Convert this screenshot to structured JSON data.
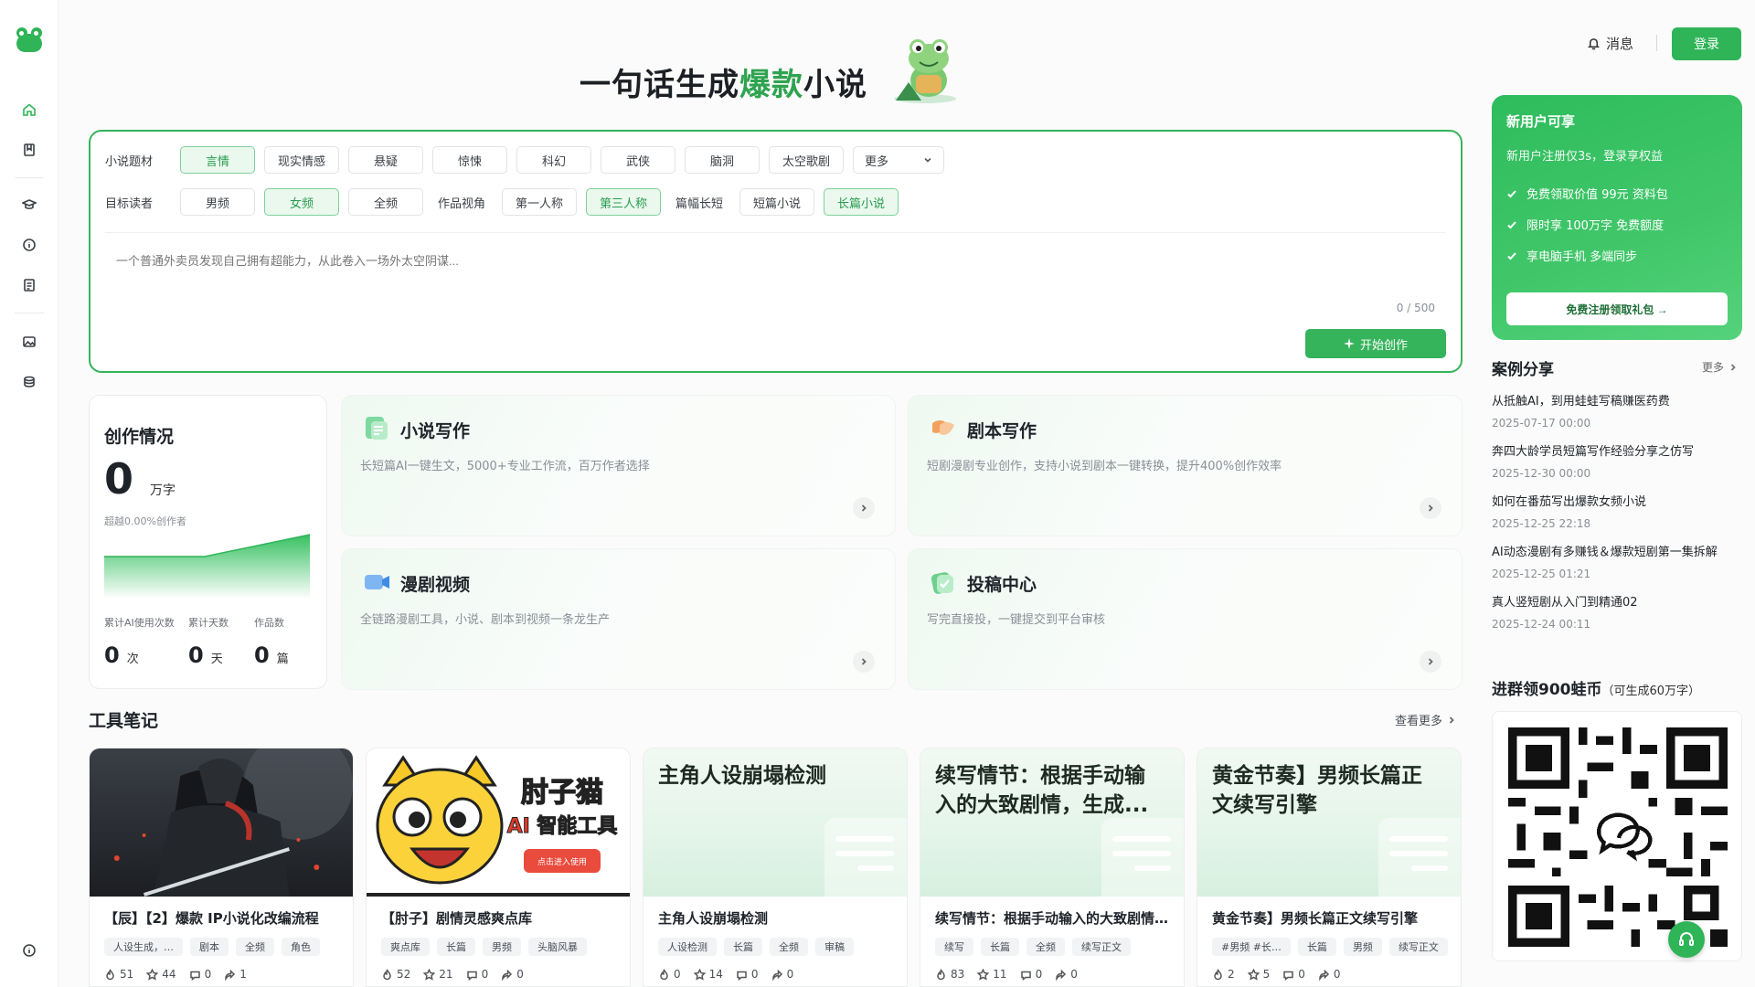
{
  "header": {
    "messages_label": "消息",
    "login_label": "登录",
    "hero_prefix": "一句话生成",
    "hero_highlight": "爆款",
    "hero_suffix": "小说"
  },
  "sidebar": {
    "icons": [
      "home-icon",
      "book-icon",
      "graduation-cap-icon",
      "info-circle-icon",
      "document-icon",
      "image-icon",
      "coins-icon",
      "help-icon"
    ]
  },
  "generator": {
    "genre_label": "小说题材",
    "genres": [
      "言情",
      "现实情感",
      "悬疑",
      "惊悚",
      "科幻",
      "武侠",
      "脑洞",
      "太空歌剧"
    ],
    "genre_more": "更多",
    "selected_genre": "言情",
    "reader_label": "目标读者",
    "readers": [
      "男频",
      "女频",
      "全频"
    ],
    "selected_reader": "女频",
    "view_label": "作品视角",
    "views": [
      "第一人称",
      "第三人称"
    ],
    "selected_view": "第三人称",
    "length_label": "篇幅长短",
    "lengths": [
      "短篇小说",
      "长篇小说"
    ],
    "selected_length": "长篇小说",
    "placeholder": "一个普通外卖员发现自己拥有超能力，从此卷入一场外太空阴谋...",
    "counter": "0 / 500",
    "start_label": "开始创作"
  },
  "stats": {
    "title": "创作情况",
    "words": "0",
    "words_unit": "万字",
    "beyond": "超越0.00%创作者",
    "ai_uses_label": "累计AI使用次数",
    "ai_uses": "0",
    "ai_uses_unit": "次",
    "days_label": "累计天数",
    "days": "0",
    "days_unit": "天",
    "works_label": "作品数",
    "works": "0",
    "works_unit": "篇"
  },
  "features": [
    {
      "title": "小说写作",
      "desc": "长短篇AI一键生文，5000+专业工作流，百万作者选择",
      "icon": "novel-icon"
    },
    {
      "title": "剧本写作",
      "desc": "短剧漫剧专业创作，支持小说到剧本一键转换，提升400%创作效率",
      "icon": "script-icon"
    },
    {
      "title": "漫剧视频",
      "desc": "全链路漫剧工具，小说、剧本到视频一条龙生产",
      "icon": "video-icon"
    },
    {
      "title": "投稿中心",
      "desc": "写完直接投，一键提交到平台审核",
      "icon": "submit-icon"
    }
  ],
  "tools": {
    "title": "工具笔记",
    "more": "查看更多",
    "cards": [
      {
        "name": "【辰】【2】爆款 IP小说化改编流程",
        "thumb": "warrior-image",
        "tags": [
          "人设生成，…",
          "剧本",
          "全频",
          "角色"
        ],
        "likes": "51",
        "stars": "44",
        "comments": "0",
        "shares": "1"
      },
      {
        "name": "【肘子】剧情灵感爽点库",
        "thumb": "cat-banner-image",
        "thumb_text": "肘子猫",
        "thumb_sub": "AI 智能工具",
        "thumb_btn": "点击进入使用",
        "tags": [
          "爽点库",
          "长篇",
          "男频",
          "头脑风暴"
        ],
        "likes": "52",
        "stars": "21",
        "comments": "0",
        "shares": "0"
      },
      {
        "name": "主角人设崩塌检测",
        "thumb_title": "主角人设崩塌检测",
        "tags": [
          "人设检测",
          "长篇",
          "全频",
          "审稿"
        ],
        "likes": "0",
        "stars": "14",
        "comments": "0",
        "shares": "0"
      },
      {
        "name": "续写情节：根据手动输入的大致剧情，生成后续章节",
        "thumb_title": "续写情节：根据手动输入的大致剧情，生成...",
        "tags": [
          "续写",
          "长篇",
          "全频",
          "续写正文"
        ],
        "likes": "83",
        "stars": "11",
        "comments": "0",
        "shares": "0"
      },
      {
        "name": "黄金节奏】男频长篇正文续写引擎",
        "thumb_title": "黄金节奏】男频长篇正文续写引擎",
        "tags": [
          "#男频 #长…",
          "长篇",
          "男频",
          "续写正文"
        ],
        "likes": "2",
        "stars": "5",
        "comments": "0",
        "shares": "0"
      }
    ]
  },
  "promo": {
    "title": "新用户可享",
    "subtitle": "新用户注册仅3s，登录享权益",
    "perks": [
      "免费领取价值 99元 资料包",
      "限时享 100万字 免费额度",
      "享电脑手机 多端同步"
    ],
    "cta": "免费注册领取礼包 →"
  },
  "cases": {
    "title": "案例分享",
    "more": "更多",
    "items": [
      {
        "title": "从抵触AI，到用蛙蛙写稿赚医药费",
        "date": "2025-07-17 00:00"
      },
      {
        "title": "奔四大龄学员短篇写作经验分享之仿写",
        "date": "2025-12-30 00:00"
      },
      {
        "title": "如何在番茄写出爆款女频小说",
        "date": "2025-12-25 22:18"
      },
      {
        "title": "AI动态漫剧有多赚钱＆爆款短剧第一集拆解",
        "date": "2025-12-25 01:21"
      },
      {
        "title": "真人竖短剧从入门到精通02",
        "date": "2025-12-24 00:11"
      }
    ]
  },
  "group": {
    "title": "进群领900蛙币",
    "note": "（可生成60万字）"
  },
  "colors": {
    "brand": "#2fb457",
    "brand_light": "#eaf8ee"
  }
}
